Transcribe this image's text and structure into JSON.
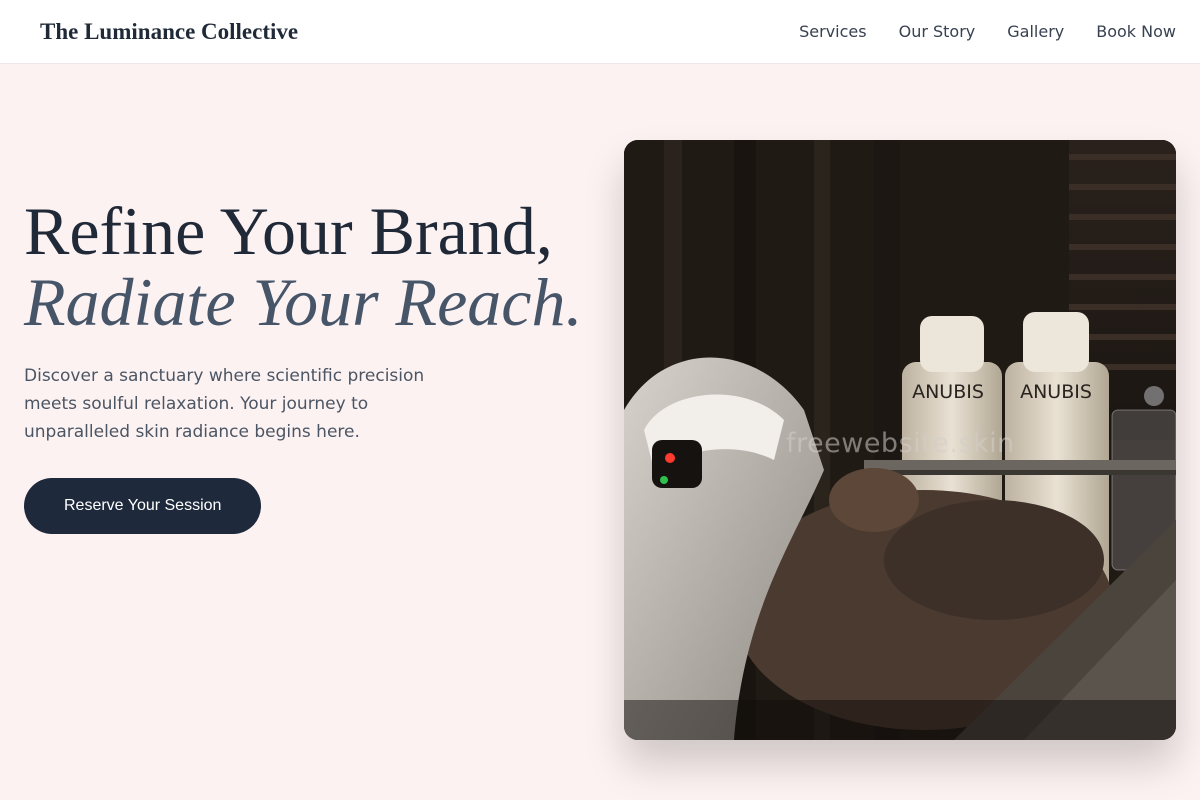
{
  "header": {
    "brand": "The Luminance Collective",
    "nav": [
      "Services",
      "Our Story",
      "Gallery",
      "Book Now"
    ]
  },
  "hero": {
    "title_line1": "Refine Your Brand,",
    "title_line2": "Radiate Your Reach.",
    "description": "Discover a sanctuary where scientific precision meets soulful relaxation. Your journey to unparalleled skin radiance begins here.",
    "cta_label": "Reserve Your Session"
  },
  "image": {
    "bottle_label_1": "ANUBIS",
    "bottle_label_2": "ANUBIS",
    "watermark": "freewebsite.skin"
  }
}
